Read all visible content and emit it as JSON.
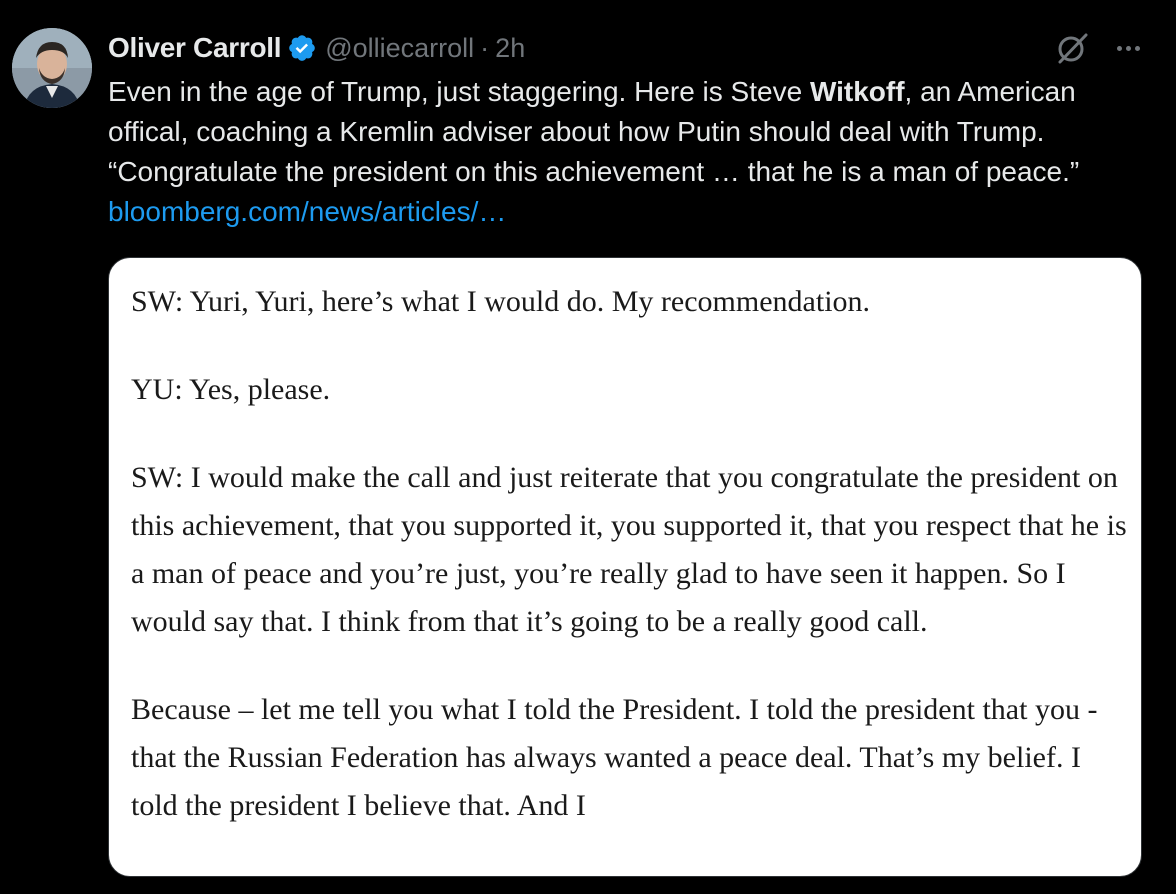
{
  "author": {
    "name": "Oliver Carroll",
    "handle": "@olliecarroll",
    "separator": "·",
    "time": "2h",
    "verified_color": "#1d9bf0"
  },
  "tweet": {
    "text_before": "Even in the age of Trump, just staggering. Here is Steve ",
    "text_bold": "Witkoff",
    "text_after": ", an American offical, coaching a Kremlin adviser about how Putin should deal with Trump. “Congratulate the president on this achievement …  that he is a man of peace.” ",
    "link_text": "bloomberg.com/news/articles/…",
    "link_color": "#1d9bf0"
  },
  "icons": {
    "grok": "grok-slash-circle-icon",
    "more": "more-horizontal-icon"
  },
  "media": {
    "paragraphs": [
      "SW: Yuri, Yuri, here’s what I would do. My recommendation.",
      "YU: Yes, please.",
      "SW: I would make the call and just reiterate that you congratulate the president on this achievement, that you supported it, you supported it, that you respect that he is a man of peace and you’re just, you’re really glad to have seen it happen. So I would say that. I think from that it’s going to be a really good call.",
      "Because – let me tell you what I told the President. I told the president that you - that the Russian Federation has always wanted a peace deal. That’s my belief. I told the president I believe that. And I"
    ]
  }
}
